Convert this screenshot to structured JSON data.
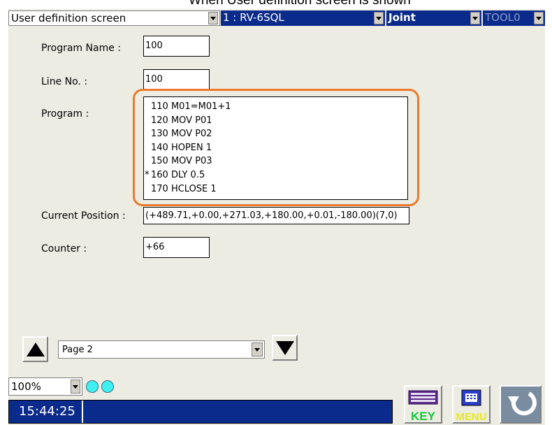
{
  "caption": "When User definition screen is shown",
  "topbar": {
    "screen_select": "User definition screen",
    "robot_select": "1 : RV-6SQL",
    "jog_mode": "Joint",
    "tool_select": "TOOL0"
  },
  "fields": {
    "program_name_label": "Program Name :",
    "program_name_value": "100",
    "line_no_label": "Line No. :",
    "line_no_value": "100",
    "program_label": "Program :",
    "program_lines": [
      {
        "marker": "",
        "text": "110 M01=M01+1"
      },
      {
        "marker": "",
        "text": "120 MOV P01"
      },
      {
        "marker": "",
        "text": "130 MOV P02"
      },
      {
        "marker": "",
        "text": "140 HOPEN 1"
      },
      {
        "marker": "",
        "text": "150 MOV P03"
      },
      {
        "marker": "*",
        "text": "160 DLY 0.5"
      },
      {
        "marker": "",
        "text": "170 HCLOSE 1"
      }
    ],
    "current_position_label": "Current Position :",
    "current_position_value": "(+489.71,+0.00,+271.03,+180.00,+0.01,-180.00)(7,0)",
    "counter_label": "Counter :",
    "counter_value": "+66"
  },
  "page_nav": {
    "page_select": "Page 2"
  },
  "bottom": {
    "zoom": "100%",
    "clock": "15:44:25",
    "key_label": "KEY",
    "menu_label": "MENU"
  },
  "colors": {
    "highlight": "#ec7a2a",
    "navy": "#0a2a8c",
    "lamp": "#3ff0f0"
  }
}
